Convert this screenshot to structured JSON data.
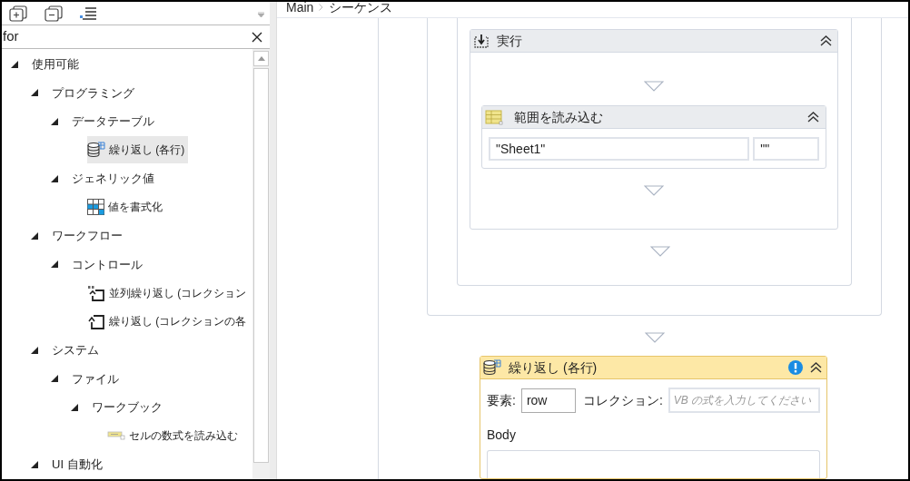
{
  "search": {
    "value": "for"
  },
  "tree": [
    {
      "label": "使用可能",
      "kind": "group",
      "expanded": true,
      "selected": false,
      "children": [
        {
          "label": "プログラミング",
          "kind": "group",
          "expanded": true,
          "selected": false,
          "children": [
            {
              "label": "データテーブル",
              "kind": "group",
              "expanded": true,
              "selected": false,
              "children": [
                {
                  "label": "繰り返し (各行)",
                  "kind": "database",
                  "selected": true
                }
              ]
            },
            {
              "label": "ジェネリック値",
              "kind": "group",
              "expanded": true,
              "selected": false,
              "children": [
                {
                  "label": "値を書式化",
                  "kind": "grid",
                  "selected": false
                }
              ]
            }
          ]
        },
        {
          "label": "ワークフロー",
          "kind": "group",
          "expanded": true,
          "selected": false,
          "children": [
            {
              "label": "コントロール",
              "kind": "group",
              "expanded": true,
              "selected": false,
              "children": [
                {
                  "label": "並列繰り返し (コレクション",
                  "kind": "parallel-loop",
                  "selected": false
                },
                {
                  "label": "繰り返し (コレクションの各",
                  "kind": "loop",
                  "selected": false
                }
              ]
            }
          ]
        },
        {
          "label": "システム",
          "kind": "group",
          "expanded": true,
          "selected": false,
          "children": [
            {
              "label": "ファイル",
              "kind": "group",
              "expanded": true,
              "selected": false,
              "children": [
                {
                  "label": "ワークブック",
                  "kind": "group",
                  "expanded": true,
                  "selected": false,
                  "children": [
                    {
                      "label": "セルの数式を読み込む",
                      "kind": "cell",
                      "selected": false
                    }
                  ]
                }
              ]
            }
          ]
        },
        {
          "label": "UI 自動化",
          "kind": "group",
          "expanded": true,
          "selected": false
        }
      ]
    }
  ],
  "breadcrumb": [
    "Main",
    "シーケンス"
  ],
  "execute_block": {
    "title": "実行",
    "activity": {
      "title": "範囲を読み込む",
      "fields": [
        "\"Sheet1\"",
        "\"\""
      ]
    }
  },
  "foreach_block": {
    "title": "繰り返し (各行)",
    "warning": true,
    "item_label": "要素:",
    "item_value": "row",
    "collection_label": "コレクション:",
    "collection_placeholder": "VB の式を入力してください",
    "body_label": "Body"
  }
}
